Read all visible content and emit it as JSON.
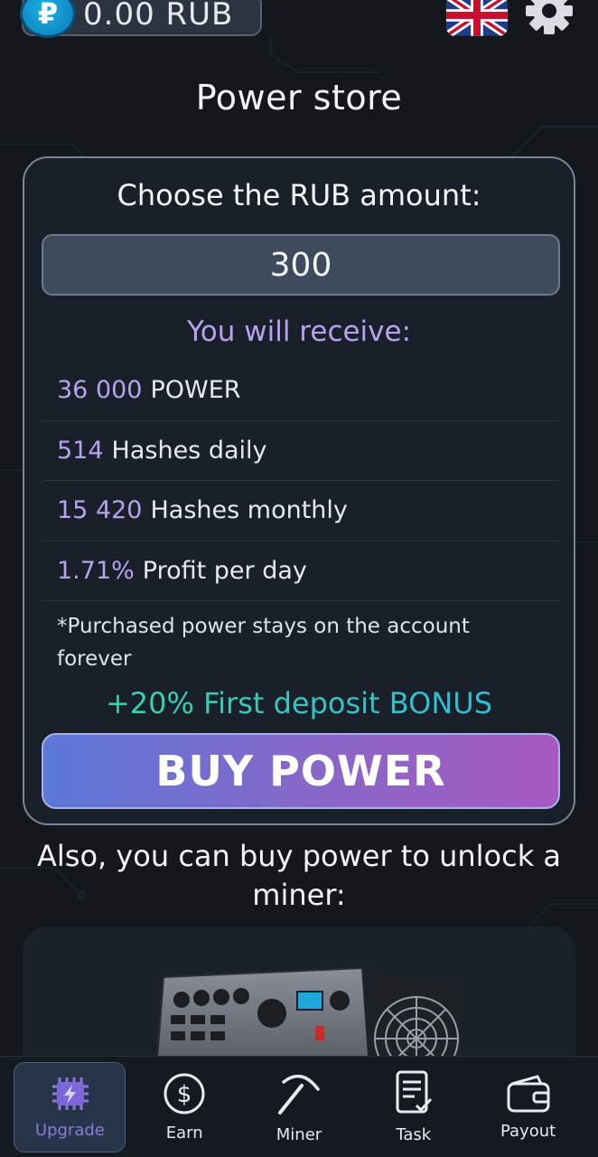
{
  "header": {
    "balance": "0.00 RUB",
    "currency_symbol": "₽",
    "language_icon": "uk-flag-icon",
    "settings_icon": "gear-icon"
  },
  "page_title": "Power store",
  "store": {
    "heading": "Choose the RUB amount:",
    "amount_value": "300",
    "receive_title": "You will receive:",
    "rows": [
      {
        "value": "36 000",
        "label": "POWER"
      },
      {
        "value": "514",
        "label": "Hashes daily"
      },
      {
        "value": "15 420",
        "label": "Hashes monthly"
      },
      {
        "value": "1.71%",
        "label": "Profit per day"
      }
    ],
    "note": "*Purchased power stays on the account forever",
    "bonus": "+20% First deposit BONUS",
    "buy_label": "BUY POWER"
  },
  "also_text": "Also, you can buy power to unlock a miner:",
  "nav": [
    {
      "label": "Upgrade",
      "icon": "chip-bolt-icon",
      "active": true
    },
    {
      "label": "Earn",
      "icon": "dollar-circle-icon",
      "active": false
    },
    {
      "label": "Miner",
      "icon": "pickaxe-icon",
      "active": false
    },
    {
      "label": "Task",
      "icon": "checklist-icon",
      "active": false
    },
    {
      "label": "Payout",
      "icon": "wallet-icon",
      "active": false
    }
  ],
  "colors": {
    "accent_purple": "#b7a2ef",
    "bonus_green": "#3ed7a0",
    "button_start": "#5b78d8",
    "button_end": "#a65ac0",
    "background": "#14181d"
  }
}
